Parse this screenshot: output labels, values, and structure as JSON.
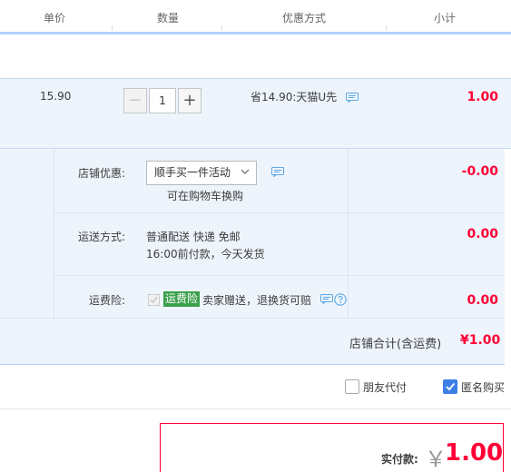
{
  "header": {
    "columns": [
      "单价",
      "数量",
      "优惠方式",
      "小计"
    ]
  },
  "item": {
    "price": "15.90",
    "quantity": "1",
    "minus_label": "−",
    "plus_label": "+",
    "promo_text": "省14.90:天猫U先",
    "subtotal": "1.00"
  },
  "shop_discount": {
    "label": "店铺优惠:",
    "selected": "顺手买一件活动",
    "note": "可在购物车换购",
    "amount": "-0.00"
  },
  "shipping": {
    "label": "运送方式:",
    "line1": "普通配送 快递 免邮",
    "line2": "16:00前付款，今天发货",
    "amount": "0.00"
  },
  "freight_insurance": {
    "label": "运费险:",
    "tag": "运费险",
    "text": "卖家赠送，退换货可赔",
    "amount": "0.00"
  },
  "shop_total": {
    "label": "店铺合计(含运费)",
    "value": "¥1.00"
  },
  "options": {
    "friend_pay": "朋友代付",
    "anonymous": "匿名购买",
    "friend_pay_checked": false,
    "anonymous_checked": true
  },
  "payment": {
    "label": "实付款:",
    "currency": "￥",
    "amount": "1.00"
  },
  "colors": {
    "accent_red": "#ff0036",
    "row_bg": "#eef4fc",
    "tag_green": "#3ba04c",
    "checkbox_blue": "#3d7fe6"
  }
}
